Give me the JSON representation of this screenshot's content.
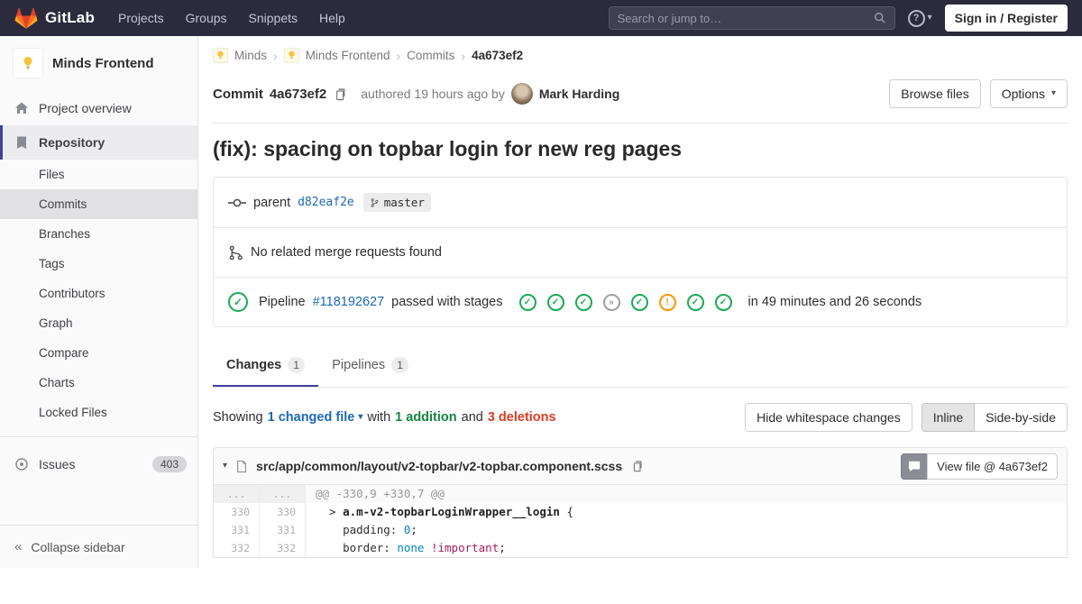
{
  "colors": {
    "accent": "#41419f",
    "link": "#1b69b6",
    "success": "#1aaa55",
    "warning": "#fc9403",
    "danger": "#db3b21",
    "addition": "#168544"
  },
  "navbar": {
    "brand": "GitLab",
    "menu": [
      "Projects",
      "Groups",
      "Snippets",
      "Help"
    ],
    "search_placeholder": "Search or jump to…",
    "sign_in": "Sign in / Register"
  },
  "sidebar": {
    "project_name": "Minds Frontend",
    "overview": "Project overview",
    "repository": "Repository",
    "repo_items": [
      "Files",
      "Commits",
      "Branches",
      "Tags",
      "Contributors",
      "Graph",
      "Compare",
      "Charts",
      "Locked Files"
    ],
    "issues_label": "Issues",
    "issues_count": "403",
    "collapse": "Collapse sidebar"
  },
  "breadcrumb": {
    "group": "Minds",
    "project": "Minds Frontend",
    "section": "Commits",
    "sha": "4a673ef2"
  },
  "commit": {
    "label": "Commit",
    "sha": "4a673ef2",
    "authored": "authored 19 hours ago by",
    "author": "Mark Harding",
    "browse_files": "Browse files",
    "options": "Options",
    "title": "(fix): spacing on topbar login for new reg pages"
  },
  "meta": {
    "parent_label": "parent",
    "parent_sha": "d82eaf2e",
    "branch": "master",
    "no_mr": "No related merge requests found"
  },
  "pipeline": {
    "label": "Pipeline",
    "id": "#118192627",
    "status_text": "passed with stages",
    "status_glyph": "✓",
    "duration": "in 49 minutes and 26 seconds",
    "stages": [
      {
        "cls": "stage success",
        "glyph": "✓"
      },
      {
        "cls": "stage success",
        "glyph": "✓"
      },
      {
        "cls": "stage success",
        "glyph": "✓"
      },
      {
        "cls": "stage skipped",
        "glyph": "»"
      },
      {
        "cls": "stage success",
        "glyph": "✓"
      },
      {
        "cls": "stage warning",
        "glyph": "!"
      },
      {
        "cls": "stage success",
        "glyph": "✓"
      },
      {
        "cls": "stage success",
        "glyph": "✓"
      }
    ]
  },
  "tabs": {
    "changes": "Changes",
    "changes_count": "1",
    "pipelines": "Pipelines",
    "pipelines_count": "1"
  },
  "summary": {
    "showing": "Showing",
    "changed_file": "1 changed file",
    "with_text": "with",
    "addition": "1 addition",
    "and_text": "and",
    "deletions": "3 deletions",
    "hide_ws": "Hide whitespace changes",
    "inline": "Inline",
    "side_by_side": "Side-by-side"
  },
  "diff": {
    "path": "src/app/common/layout/v2-topbar/v2-topbar.component.scss",
    "view_file": "View file @ 4a673ef2",
    "hunk": {
      "old": "...",
      "new": "...",
      "text": "@@ -330,9 +330,7 @@"
    },
    "rows": [
      {
        "old": "330",
        "new": "330",
        "indent": "  > ",
        "sel": "a.m-v2-topbarLoginWrapper__login",
        "tail": " {"
      },
      {
        "old": "331",
        "new": "331",
        "indent": "    ",
        "prop": "padding",
        "colon": ": ",
        "val": "0",
        "semi": ";"
      },
      {
        "old": "332",
        "new": "332",
        "indent": "    ",
        "prop": "border",
        "colon": ": ",
        "val": "none",
        "imp": " !important",
        "semi": ";"
      }
    ]
  }
}
